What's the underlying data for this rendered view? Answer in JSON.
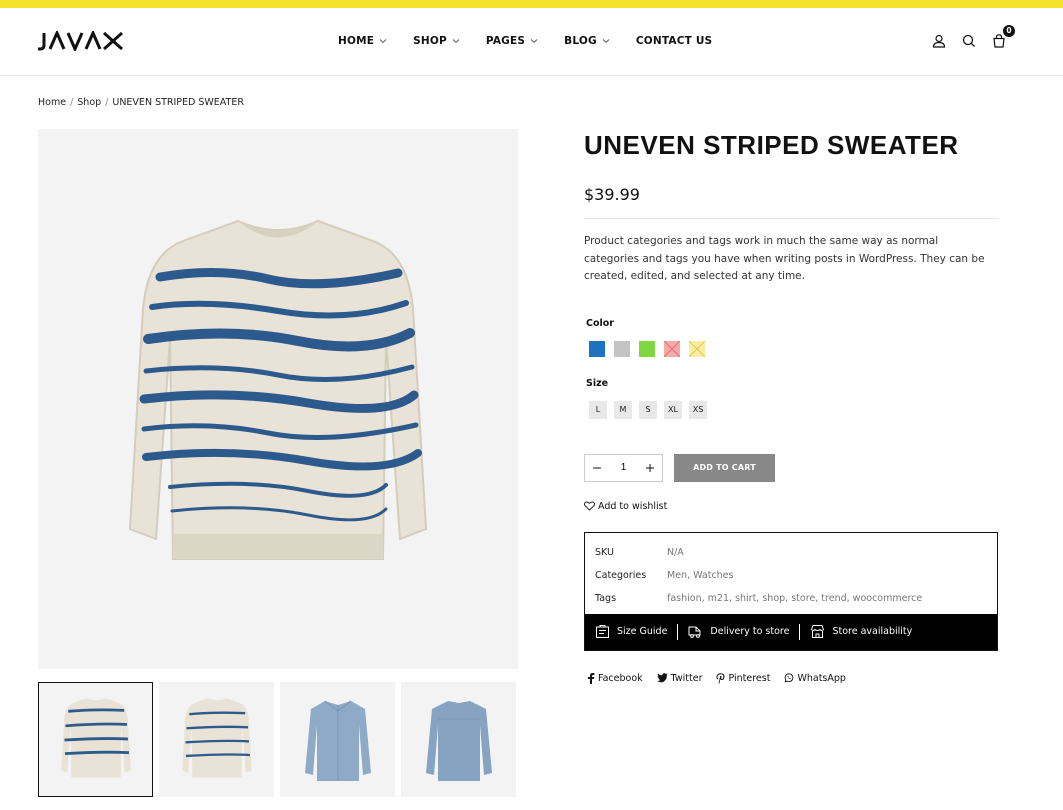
{
  "header": {
    "logo_text": "JAVAX",
    "nav": [
      {
        "label": "HOME",
        "has_dropdown": true
      },
      {
        "label": "SHOP",
        "has_dropdown": true
      },
      {
        "label": "PAGES",
        "has_dropdown": true
      },
      {
        "label": "BLOG",
        "has_dropdown": true
      },
      {
        "label": "CONTACT US",
        "has_dropdown": false
      }
    ],
    "icons": [
      "user-icon",
      "search-icon",
      "cart-icon"
    ],
    "cart_count": "0"
  },
  "breadcrumb": {
    "home": "Home",
    "shop": "Shop",
    "current": "UNEVEN STRIPED SWEATER",
    "separator": "/"
  },
  "gallery": {
    "thumbnails": [
      "sweater-front",
      "sweater-front-alt",
      "blue-shirt-front",
      "blue-shirt-back"
    ],
    "active_index": 0
  },
  "product": {
    "title": "UNEVEN STRIPED SWEATER",
    "price": "$39.99",
    "description": "Product categories and tags work in much the same way as normal categories and tags you have when writing posts in WordPress. They can be created, edited, and selected at any time.",
    "color_label": "Color",
    "colors": [
      {
        "hex": "#1e73be",
        "available": true
      },
      {
        "hex": "#c4c4c4",
        "available": true
      },
      {
        "hex": "#81d742",
        "available": true
      },
      {
        "hex": "#f5a9a9",
        "available": false
      },
      {
        "hex": "#fbeea0",
        "available": false
      }
    ],
    "size_label": "Size",
    "sizes": [
      "L",
      "M",
      "S",
      "XL",
      "XS"
    ],
    "quantity": "1",
    "add_to_cart": "ADD TO CART",
    "wishlist": "Add to wishlist"
  },
  "meta": {
    "sku_label": "SKU",
    "sku_value": "N/A",
    "categories_label": "Categories",
    "categories": [
      "Men",
      "Watches"
    ],
    "tags_label": "Tags",
    "tags": [
      "fashion",
      "m21",
      "shirt",
      "shop",
      "store",
      "trend",
      "woocommerce"
    ],
    "footer": {
      "size_guide": "Size Guide",
      "delivery": "Delivery to store",
      "availability": "Store availability"
    }
  },
  "share": {
    "facebook": "Facebook",
    "twitter": "Twitter",
    "pinterest": "Pinterest",
    "whatsapp": "WhatsApp"
  },
  "colors": {
    "accent_bar": "#f5e12a",
    "sweater_base": "#e8e3d6",
    "sweater_stripe": "#2d5a8c",
    "shirt_blue": "#8eaac6"
  }
}
